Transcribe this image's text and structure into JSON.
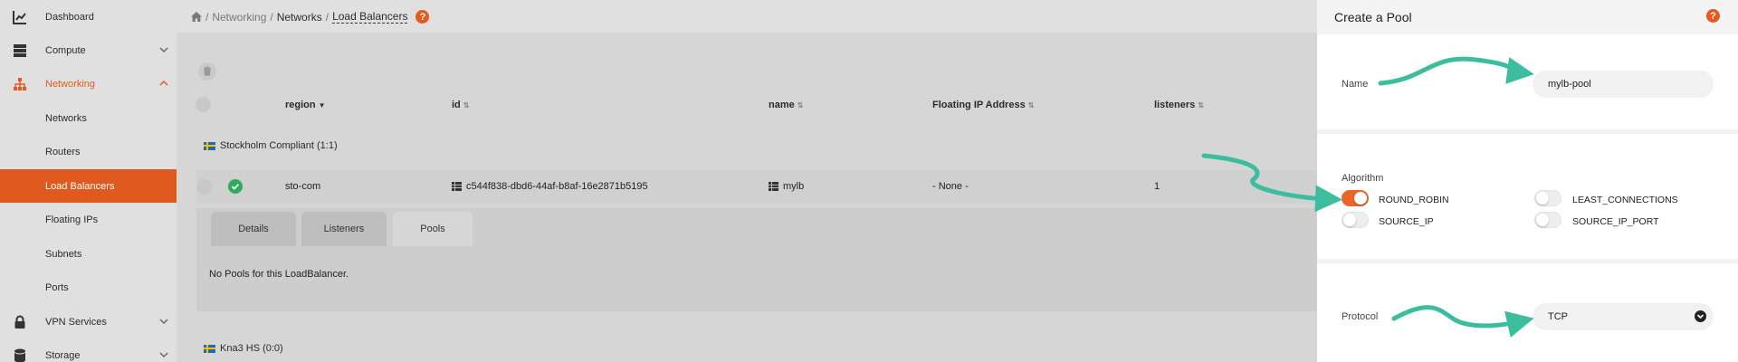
{
  "sidebar": {
    "items": [
      {
        "label": "Dashboard",
        "icon": "chart-icon"
      },
      {
        "label": "Compute",
        "icon": "server-icon"
      },
      {
        "label": "Networking",
        "icon": "network-icon"
      },
      {
        "label": "Networks"
      },
      {
        "label": "Routers"
      },
      {
        "label": "Load Balancers"
      },
      {
        "label": "Floating IPs"
      },
      {
        "label": "Subnets"
      },
      {
        "label": "Ports"
      },
      {
        "label": "VPN Services",
        "icon": "lock-icon"
      },
      {
        "label": "Storage",
        "icon": "database-icon"
      }
    ]
  },
  "breadcrumb": {
    "items": [
      "Networking",
      "Networks",
      "Load Balancers"
    ],
    "separator": "/"
  },
  "table": {
    "columns": [
      "region",
      "id",
      "name",
      "Floating IP Address",
      "listeners"
    ],
    "groups": [
      {
        "label": "Stockholm Compliant (1:1)"
      },
      {
        "label": "Kna3 HS (0:0)"
      }
    ],
    "row": {
      "region": "sto-com",
      "id": "c544f838-dbd6-44af-b8af-16e2871b5195",
      "name": "mylb",
      "floating_ip": "- None -",
      "listeners": "1"
    }
  },
  "detail_tabs": {
    "tabs": [
      "Details",
      "Listeners",
      "Pools"
    ],
    "active": "Pools",
    "empty_message": "No Pools for this LoadBalancer."
  },
  "drawer": {
    "title": "Create a Pool",
    "name": {
      "label": "Name",
      "value": "mylb-pool"
    },
    "algorithm": {
      "label": "Algorithm",
      "options": [
        {
          "label": "ROUND_ROBIN",
          "on": true
        },
        {
          "label": "LEAST_CONNECTIONS",
          "on": false
        },
        {
          "label": "SOURCE_IP",
          "on": false
        },
        {
          "label": "SOURCE_IP_PORT",
          "on": false
        }
      ]
    },
    "protocol": {
      "label": "Protocol",
      "value": "TCP"
    }
  },
  "colors": {
    "accent": "#e55a1e",
    "success": "#2eab5c",
    "arrow": "#3dbd9f"
  }
}
